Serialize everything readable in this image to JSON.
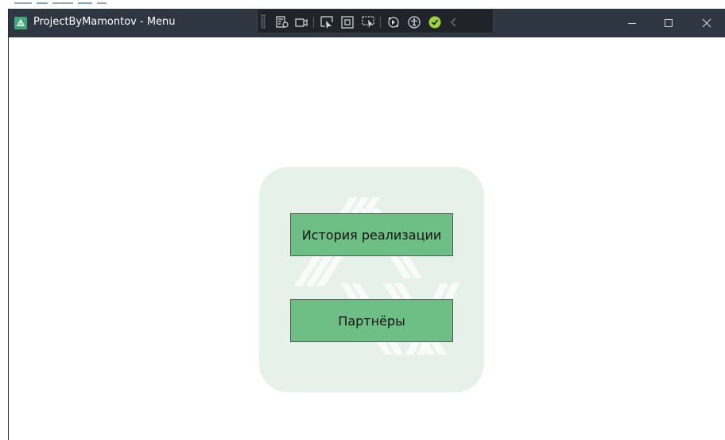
{
  "window": {
    "title": "ProjectByMamontov - Menu",
    "titlebar_color": "#2e3642",
    "app_icon": "app-leaf-icon"
  },
  "debug_toolbar": {
    "icons": [
      "live-visual-tree-icon",
      "record-video-icon",
      "select-element-icon",
      "display-layout-adorners-icon",
      "track-focused-element-icon",
      "hot-reload-icon",
      "accessibility-checker-icon",
      "binding-failures-ok-icon",
      "collapse-toolbar-chevron-icon"
    ]
  },
  "caption_buttons": {
    "minimize": "minimize-icon",
    "maximize": "maximize-icon",
    "close": "close-icon"
  },
  "menu": {
    "panel_color": "#e5f1e9",
    "button_color": "#6dbf86",
    "buttons": [
      {
        "label": "История реализации"
      },
      {
        "label": "Партнёры"
      }
    ]
  }
}
